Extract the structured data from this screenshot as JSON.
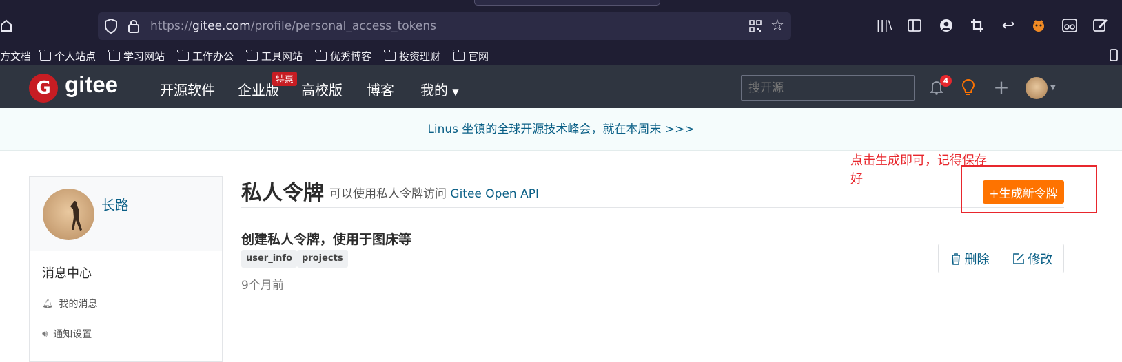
{
  "browser": {
    "url_protocol": "https://",
    "url_domain": "gitee.com",
    "url_path": "/profile/personal_access_tokens",
    "bookmarks": [
      "方文档",
      "个人站点",
      "学习网站",
      "工作办公",
      "工具网站",
      "优秀博客",
      "投资理财",
      "官网"
    ]
  },
  "nav": {
    "logo_text": "gitee",
    "logo_mark": "G",
    "links": [
      "开源软件",
      "企业版",
      "高校版",
      "博客",
      "我的"
    ],
    "enterprise_badge": "特惠",
    "search_placeholder": "搜开源",
    "notification_count": "4"
  },
  "notice": {
    "text": "Linus 坐镇的全球开源技术峰会，就在本周末 >>>"
  },
  "sidebar": {
    "username": "长路",
    "menu_title": "消息中心",
    "items": [
      "我的消息",
      "通知设置"
    ]
  },
  "main": {
    "title": "私人令牌",
    "subtitle_prefix": "可以使用私人令牌访问",
    "subtitle_link": "Gitee Open API",
    "generate_button": "+生成新令牌",
    "annotation": "点击生成即可，记得保存好",
    "token": {
      "name": "创建私人令牌，使用于图床等",
      "scopes": [
        "user_info",
        "projects"
      ],
      "time": "9个月前",
      "delete_label": "删除",
      "edit_label": "修改"
    }
  },
  "colors": {
    "nav_bg": "#2f3540",
    "brand_red": "#c71d23",
    "accent_orange": "#fe7300",
    "link_blue": "#0a5f86",
    "annotation_red": "#e8272d"
  }
}
